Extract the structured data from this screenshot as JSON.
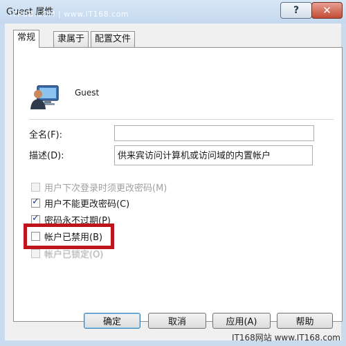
{
  "window": {
    "title": "Guest 属性",
    "help_symbol": "?",
    "close_symbol": "✕",
    "watermark_top": "ITPUB.COM | www.IT168.com"
  },
  "tabs": [
    "常规",
    "隶属于",
    "配置文件"
  ],
  "user": {
    "name": "Guest",
    "icon": "user-computer-icon"
  },
  "fields": {
    "full_name_label": "全名(F):",
    "full_name_value": "",
    "description_label": "描述(D):",
    "description_value": "供来宾访问计算机或访问域的内置帐户"
  },
  "checkboxes": [
    {
      "label": "用户下次登录时须更改密码(M)",
      "checked": false,
      "disabled": true
    },
    {
      "label": "用户不能更改密码(C)",
      "checked": true,
      "disabled": false
    },
    {
      "label": "密码永不过期(P)",
      "checked": true,
      "disabled": false
    },
    {
      "label": "帐户已禁用(B)",
      "checked": false,
      "disabled": false
    },
    {
      "label": "帐户已锁定(O)",
      "checked": false,
      "disabled": true
    }
  ],
  "buttons": {
    "ok": "确定",
    "cancel": "取消",
    "apply": "应用(A)",
    "help": "帮助"
  },
  "watermark_bottom": "IT168网站 www.IT168.com",
  "colors": {
    "highlight": "#c0141c",
    "titlebar": "#c9dcef"
  }
}
